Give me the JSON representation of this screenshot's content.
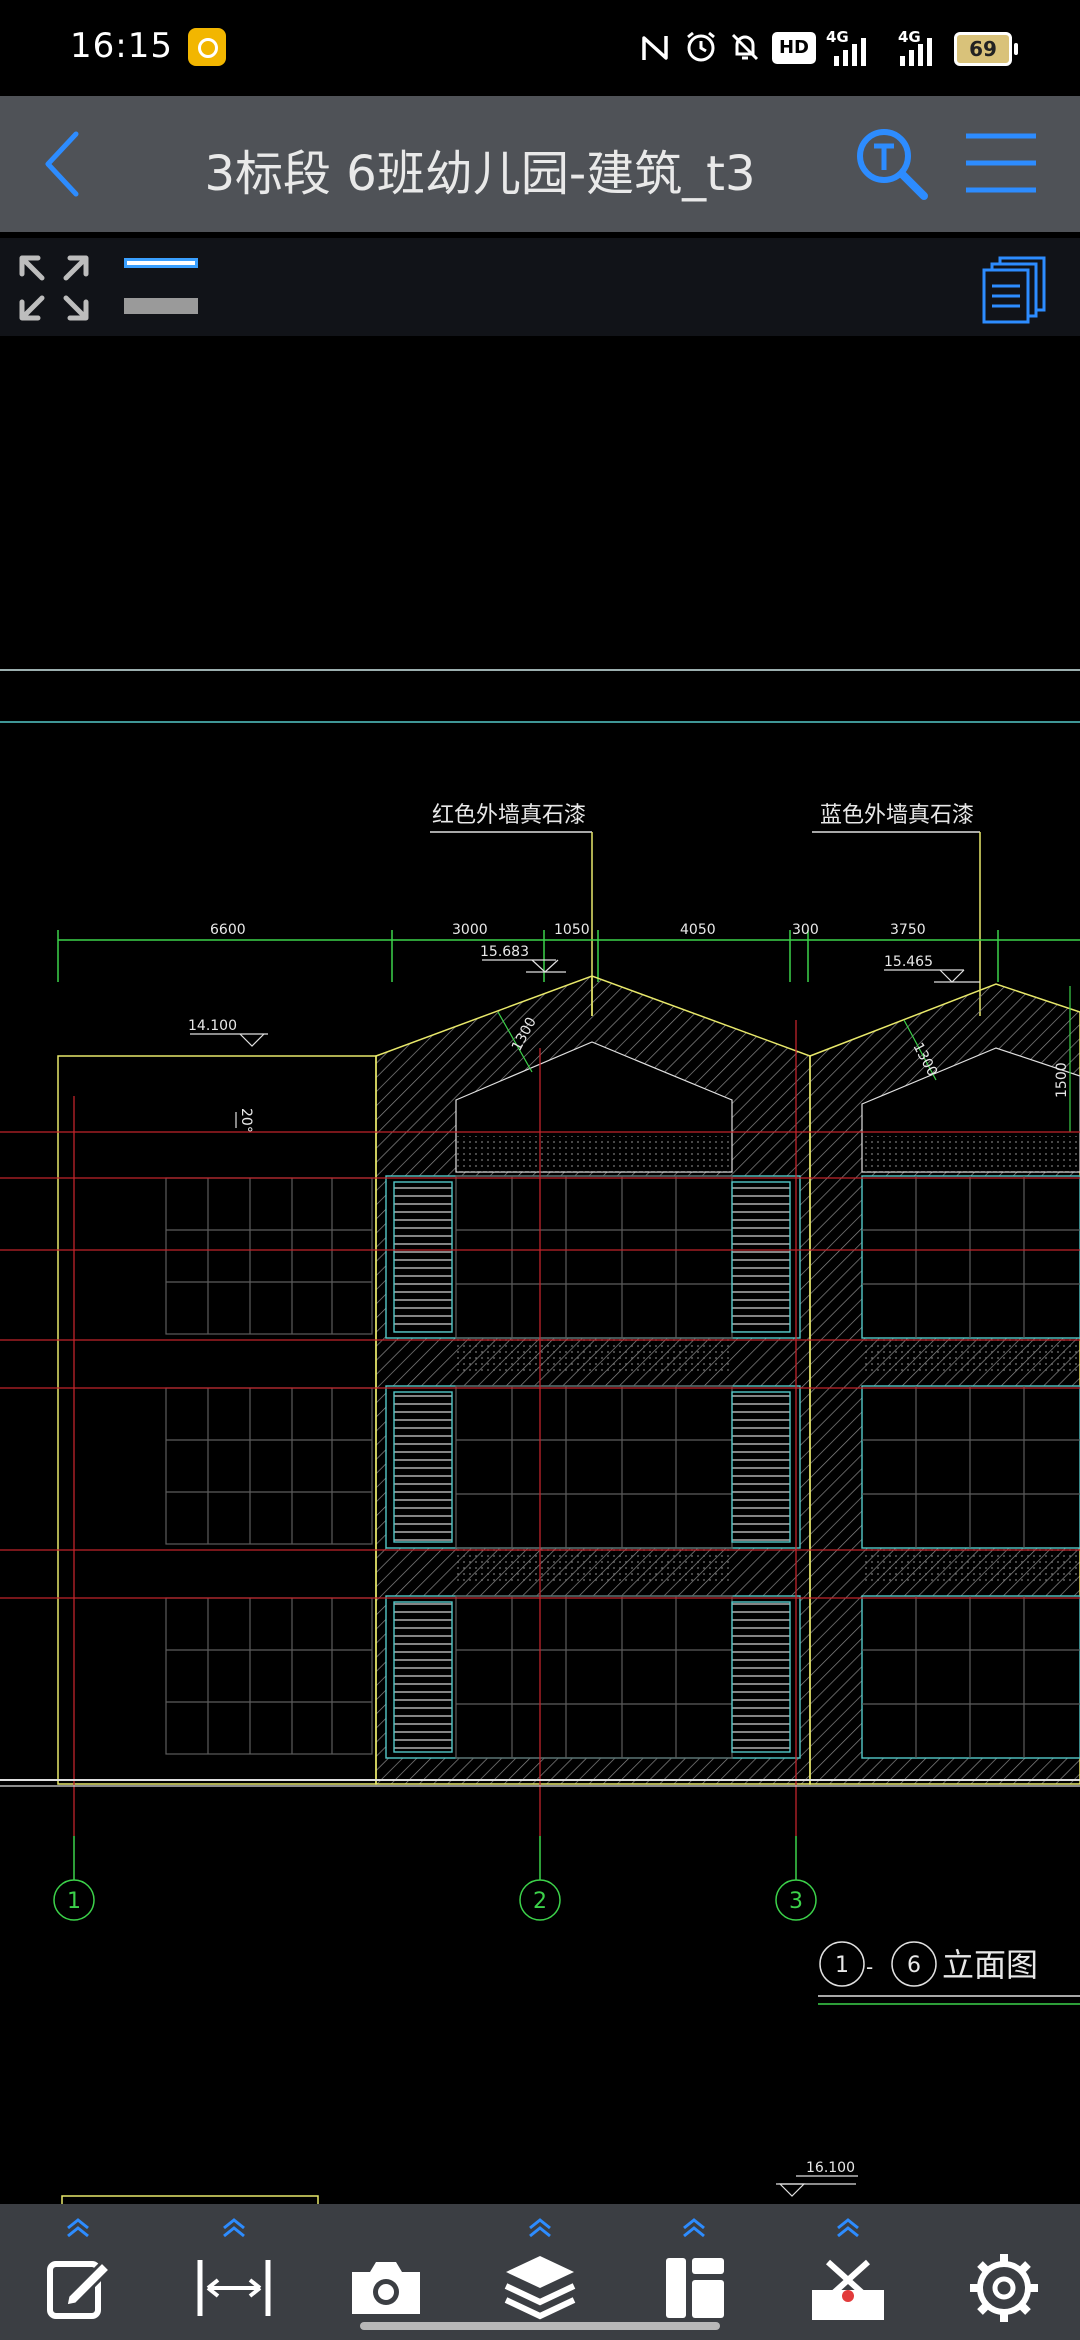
{
  "status_bar": {
    "time": "16:15",
    "icons": [
      "nfc-icon",
      "alarm-icon",
      "mute-icon",
      "hd-icon",
      "signal-4g-1-icon",
      "signal-4g-2-icon"
    ],
    "hd_label": "HD",
    "net1": "4G",
    "net2": "4G",
    "battery": "69"
  },
  "toolbar": {
    "title": "3标段 6班幼儿园-建筑_t3",
    "accent_color": "#2d8cff"
  },
  "drawing": {
    "annotations": {
      "red_paint": "红色外墙真石漆",
      "blue_paint": "蓝色外墙真石漆"
    },
    "dimensions": [
      "6600",
      "3000",
      "1050",
      "4050",
      "300",
      "3750"
    ],
    "elevations": {
      "e1": "15.683",
      "e2": "15.465",
      "e3": "14.100",
      "e4": "16.100"
    },
    "slope_labels": [
      "1300",
      "1300",
      "1500"
    ],
    "angle_label": "20°",
    "axes": [
      "1",
      "2",
      "3"
    ],
    "title_label": {
      "from": "1",
      "dash": "-",
      "to": "6",
      "text": "立面图"
    }
  },
  "bottom_bar": {
    "items": [
      "edit",
      "measure",
      "camera",
      "layers",
      "layout",
      "tools",
      "settings"
    ]
  }
}
